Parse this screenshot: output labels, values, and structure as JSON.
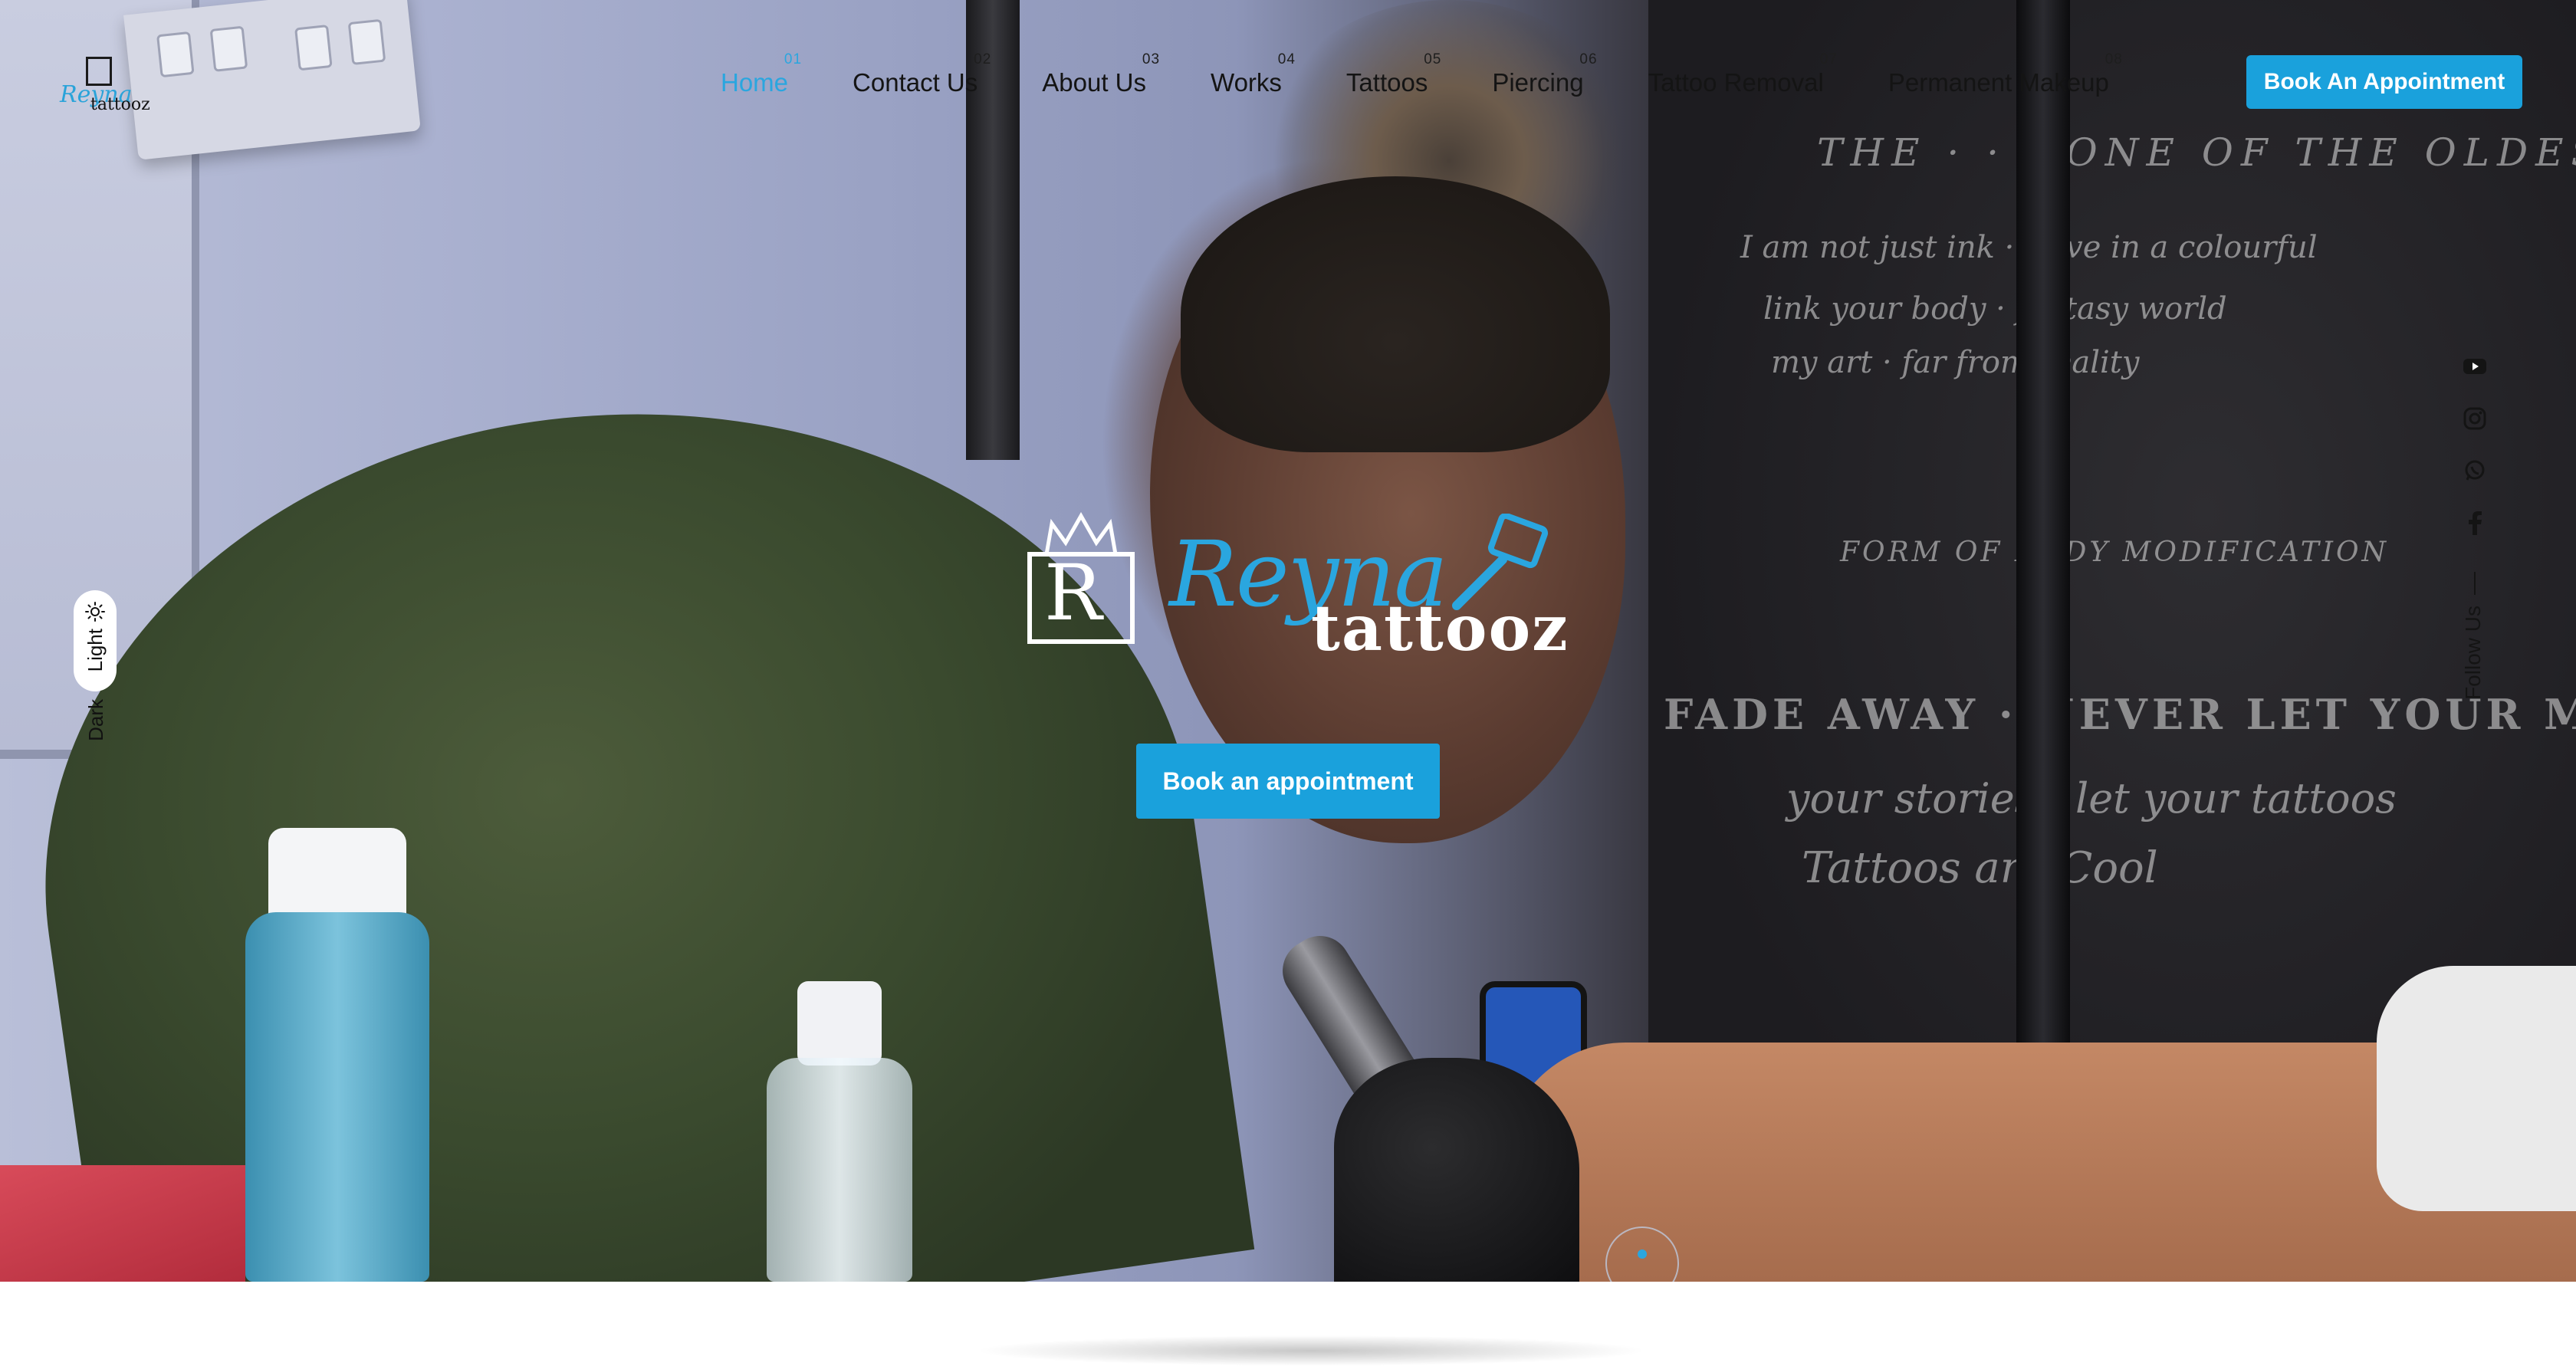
{
  "header": {
    "logo": {
      "brand_script": "Reyna",
      "brand_word": "tattooz"
    },
    "nav": [
      {
        "num": "01",
        "label": "Home",
        "active": true
      },
      {
        "num": "02",
        "label": "Contact Us",
        "active": false
      },
      {
        "num": "03",
        "label": "About Us",
        "active": false
      },
      {
        "num": "04",
        "label": "Works",
        "active": false
      },
      {
        "num": "05",
        "label": "Tattoos",
        "active": false
      },
      {
        "num": "06",
        "label": "Piercing",
        "active": false
      },
      {
        "num": "07",
        "label": "Tattoo Removal",
        "active": false
      },
      {
        "num": "08",
        "label": "Permanent Makeup",
        "active": false
      }
    ],
    "cta_label": "Book An Appointment"
  },
  "theme_toggle": {
    "light_label": "Light",
    "dark_label": "Dark",
    "selected": "Light"
  },
  "social": {
    "follow_label": "Follow Us",
    "icons": [
      "youtube-icon",
      "instagram-icon",
      "whatsapp-icon",
      "facebook-icon"
    ]
  },
  "hero": {
    "brand_script": "Reyna",
    "brand_word": "tattooz",
    "cta_label": "Book an appointment"
  },
  "colors": {
    "accent": "#1aa1dc",
    "nav_text": "#141414",
    "active_nav": "#2aa6df"
  }
}
